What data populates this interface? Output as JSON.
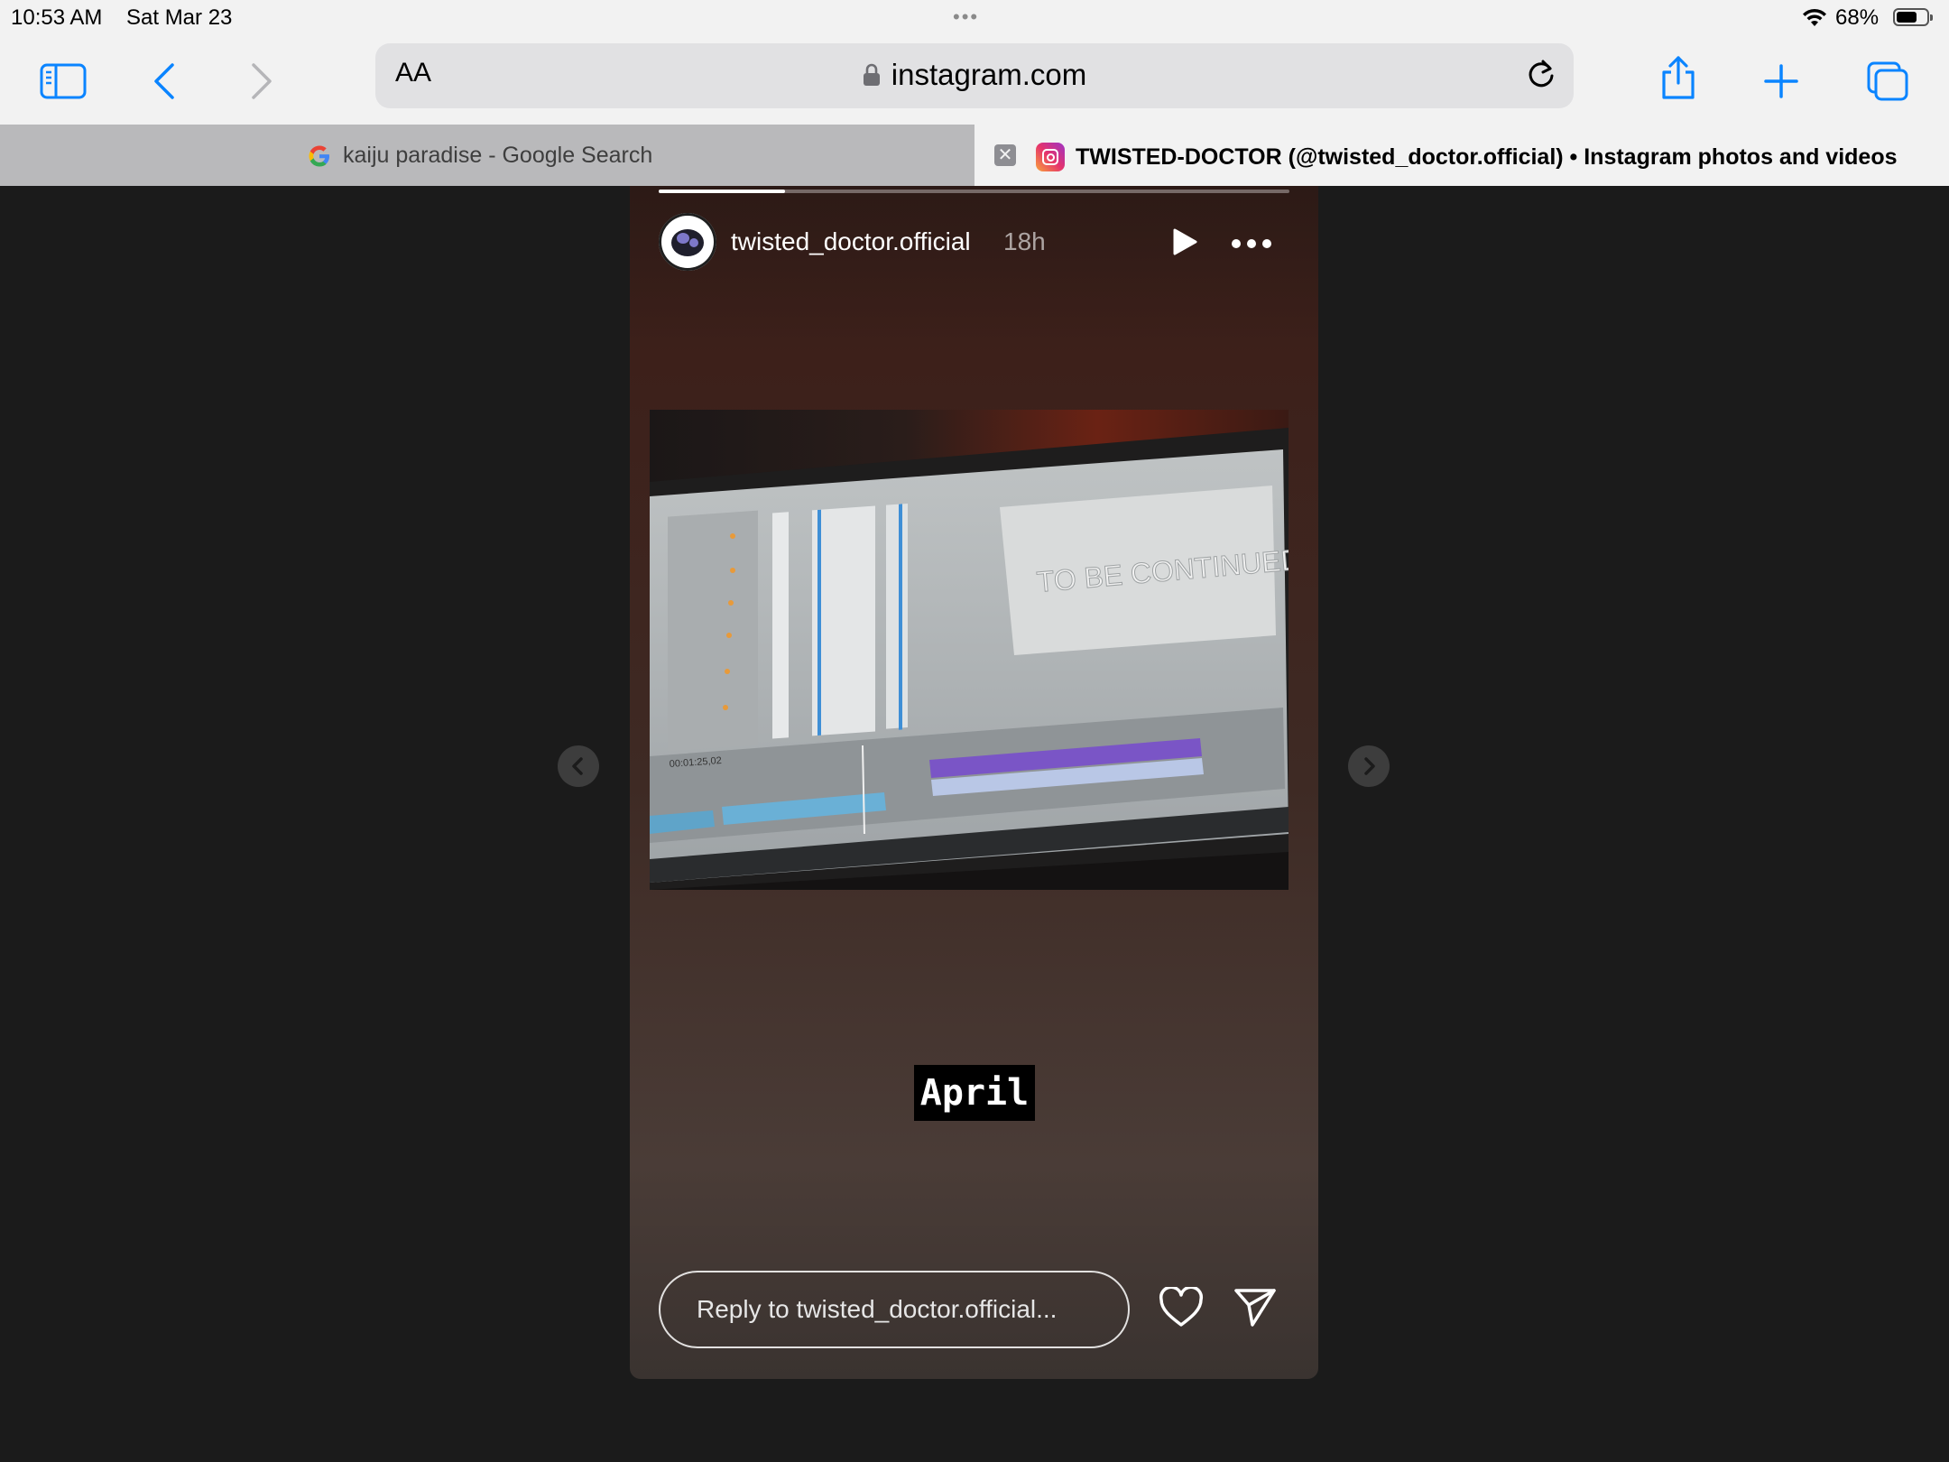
{
  "status_bar": {
    "time": "10:53 AM",
    "date": "Sat Mar 23",
    "dots": "•••",
    "battery": "68%",
    "battery_level": 0.68
  },
  "toolbar": {
    "sidebar_icon": "sidebar-icon",
    "back_icon": "chevron-left-icon",
    "forward_icon": "chevron-right-icon",
    "reader_label": "AA",
    "url": "instagram.com",
    "reload_icon": "reload-icon",
    "share_icon": "share-icon",
    "new_tab_icon": "plus-icon",
    "tabs_icon": "tabs-overview-icon",
    "accent": "#0a84ff"
  },
  "tabs": [
    {
      "title": "kaiju paradise - Google Search",
      "active": false
    },
    {
      "title": "TWISTED-DOCTOR (@twisted_doctor.official) • Instagram photos and videos",
      "active": true
    }
  ],
  "story": {
    "progress": 0.2,
    "username": "twisted_doctor.official",
    "time_ago": "18h",
    "image_text": "TO BE CONTINUED",
    "timecode": "00:01:25,02",
    "caption": "April",
    "reply_placeholder": "Reply to twisted_doctor.official..."
  }
}
